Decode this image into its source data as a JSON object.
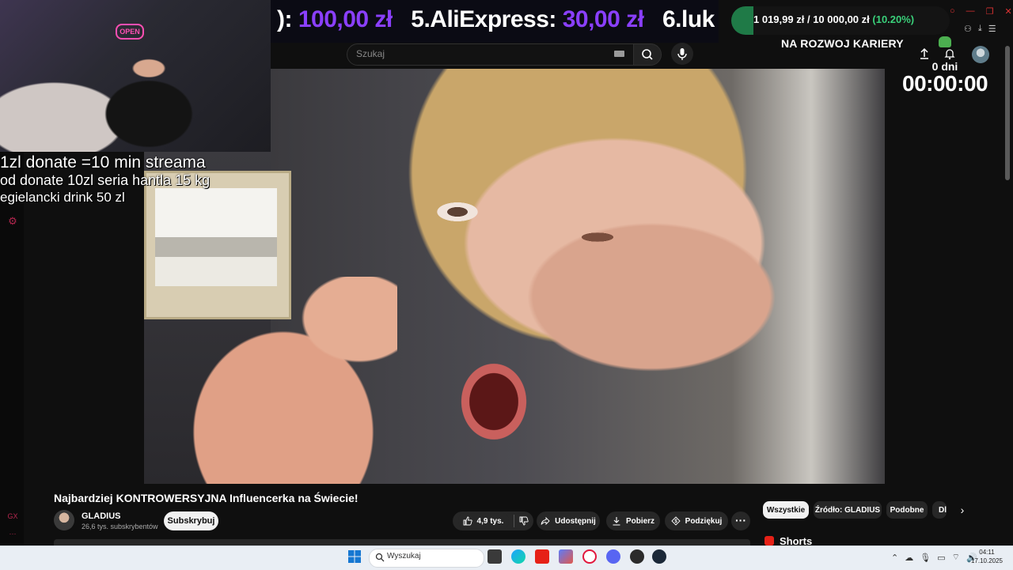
{
  "ticker": {
    "prefix": "):",
    "amount_1": "100,00 zł",
    "item_5_label": "5.AliExpress:",
    "amount_5": "30,00 zł",
    "item_6_label": "6.luk"
  },
  "goal": {
    "current": "1 019,99 zł",
    "separator": "/",
    "target": "10 000,00 zł",
    "percent": "(10.20%)",
    "progress_fraction": 0.102,
    "label": "NA ROZWOJ KARIERY"
  },
  "timer": {
    "days": "0 dni",
    "time": "00:00:00"
  },
  "header": {
    "search_placeholder": "Szukaj"
  },
  "overlay": {
    "webcam_sign": "OPEN",
    "donate_line_1": "1zl donate =10 min streama",
    "donate_line_2": "od donate 10zl seria hantla 15 kg",
    "donate_line_3": "egielancki drink 50 zl"
  },
  "video": {
    "title": "Najbardziej KONTROWERSYJNA Influencerka na Świecie!",
    "channel_name": "GLADIUS",
    "channel_subs": "26,6 tys. subskrybentów",
    "subscribe_label": "Subskrybuj",
    "like_count": "4,9 tys.",
    "share_label": "Udostępnij",
    "download_label": "Pobierz",
    "thanks_label": "Podziękuj",
    "more_label": "···"
  },
  "chips": {
    "all": "Wszystkie",
    "source": "Źródło: GLADIUS",
    "similar": "Podobne",
    "more": "Dl"
  },
  "sidebar": {
    "shorts_label": "Shorts"
  },
  "left_rail": {
    "icon_3_text": "···"
  },
  "taskbar": {
    "search_placeholder": "Wyszukaj",
    "time": "04:11",
    "date": "17.10.2025"
  },
  "colors": {
    "ticker_amount": "#8a3ffc",
    "goal_percent": "#3ad07a",
    "youtube_red": "#e62117"
  }
}
